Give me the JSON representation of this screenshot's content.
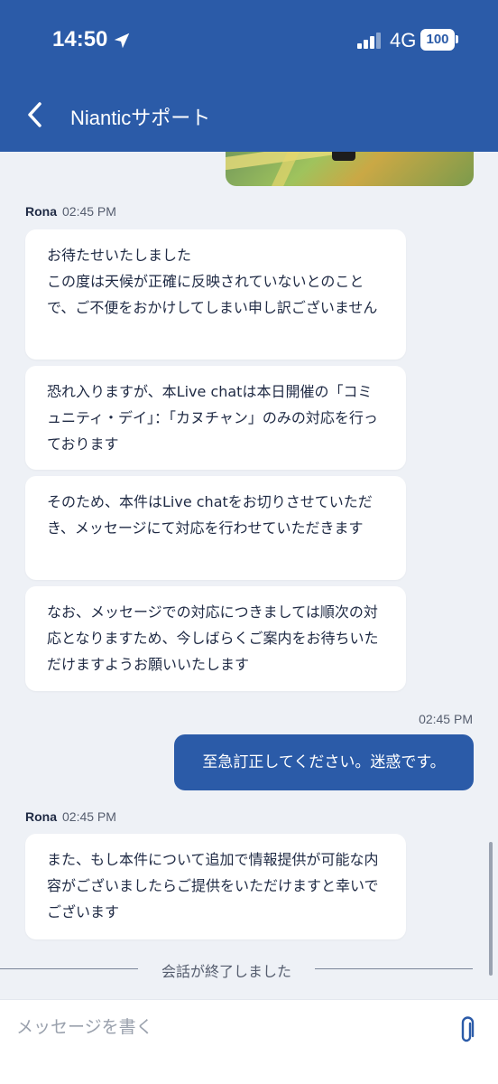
{
  "status_bar": {
    "time": "14:50",
    "network": "4G",
    "battery": "100"
  },
  "header": {
    "title": "Nianticサポート"
  },
  "messages": [
    {
      "sender": "Rona",
      "time": "02:45 PM",
      "bubbles": [
        "お待たせいたしました\nこの度は天候が正確に反映されていないとのことで、ご不便をおかけしてしまい申し訳ございません",
        "恐れ入りますが、本Live chatは本日開催の「コミュニティ・デイ」：「カヌチャン」のみの対応を行っております",
        "そのため、本件はLive chatをお切りさせていただき、メッセージにて対応を行わせていただきます",
        "なお、メッセージでの対応につきましては順次の対応となりますため、今しばらくご案内をお待ちいただけますようお願いいたします"
      ]
    },
    {
      "outgoing_time": "02:45 PM",
      "outgoing_text": "至急訂正してください。迷惑です。"
    },
    {
      "sender": "Rona",
      "time": "02:45 PM",
      "bubbles": [
        "また、もし本件について追加で情報提供が可能な内容がございましたらご提供をいただけますと幸いでございます"
      ]
    }
  ],
  "system": {
    "ended": "会話が終了しました"
  },
  "composer": {
    "placeholder": "メッセージを書く"
  },
  "colors": {
    "primary": "#2b5ba8",
    "background": "#eef1f6",
    "bubble": "#ffffff"
  },
  "icons": {
    "back": "chevron-left-icon",
    "attach": "paperclip-icon",
    "location": "location-arrow-icon",
    "signal": "signal-bars-icon"
  }
}
